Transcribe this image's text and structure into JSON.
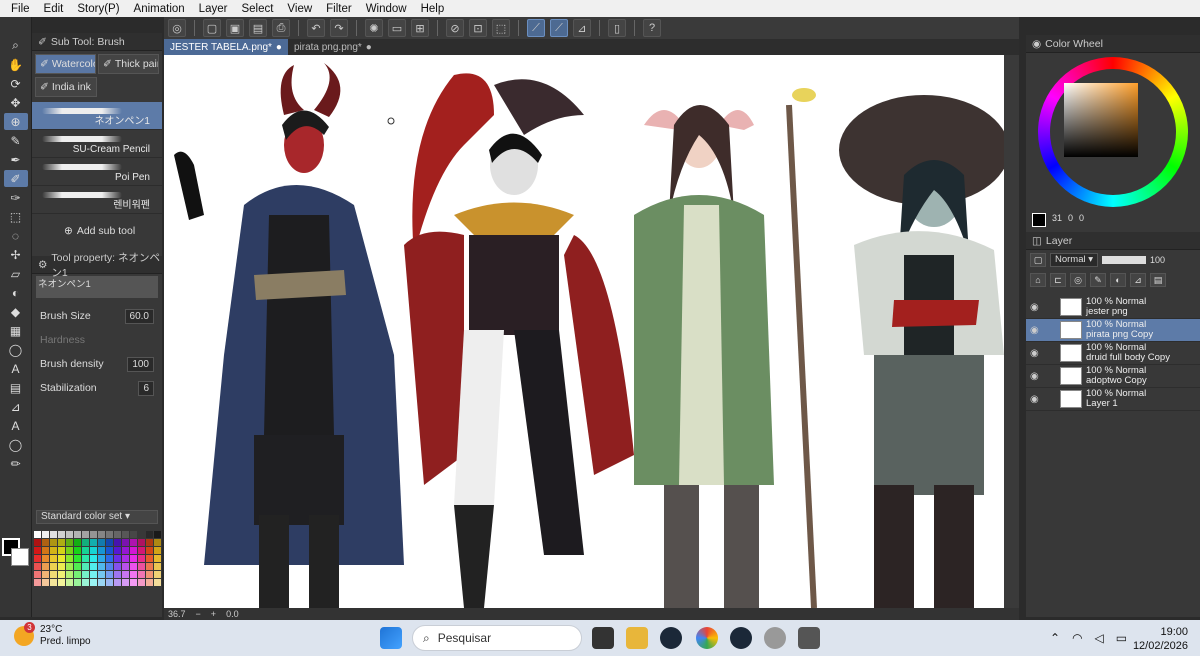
{
  "menu": [
    "File",
    "Edit",
    "Story(P)",
    "Animation",
    "Layer",
    "Select",
    "View",
    "Filter",
    "Window",
    "Help"
  ],
  "document_tabs": [
    {
      "label": "JESTER TABELA.png*",
      "active": true
    },
    {
      "label": "pirata png.png*",
      "active": false
    }
  ],
  "subtool": {
    "header": "Sub Tool: Brush",
    "groups": [
      "Watercolor",
      "Thick paint",
      "India ink"
    ],
    "brushes": [
      {
        "label": "ネオンペン1",
        "selected": true
      },
      {
        "label": "SU-Cream Pencil",
        "selected": false
      },
      {
        "label": "Poi Pen",
        "selected": false
      },
      {
        "label": "렌비워펜",
        "selected": false
      }
    ],
    "add_label": "Add sub tool"
  },
  "tool_property": {
    "header": "Tool property: ネオンペン1",
    "preset_name": "ネオンペン1",
    "brush_size_label": "Brush Size",
    "brush_size_value": "60.0",
    "hardness_label": "Hardness",
    "density_label": "Brush density",
    "density_value": "100",
    "stabilization_label": "Stabilization",
    "stabilization_value": "6"
  },
  "color_set": {
    "label": "Standard color set"
  },
  "status": {
    "zoom": "36.7",
    "angle": "0.0"
  },
  "color_wheel": {
    "header": "Color Wheel",
    "hue_color": "#ff9f2a",
    "numbers": [
      "31",
      "0",
      "0"
    ]
  },
  "layer_panel": {
    "header": "Layer",
    "blend": "Normal",
    "opacity": "100",
    "layers": [
      {
        "line1": "100 % Normal",
        "line2": "jester png",
        "selected": false
      },
      {
        "line1": "100 % Normal",
        "line2": "pirata png Copy",
        "selected": true
      },
      {
        "line1": "100 % Normal",
        "line2": "druid full body Copy",
        "selected": false
      },
      {
        "line1": "100 % Normal",
        "line2": "adoptwo Copy",
        "selected": false
      },
      {
        "line1": "100 % Normal",
        "line2": "Layer 1",
        "selected": false
      }
    ]
  },
  "taskbar": {
    "temp": "23°C",
    "weather": "Pred. limpo",
    "badge": "3",
    "search_placeholder": "Pesquisar",
    "time": "19:00",
    "date": "12/02/2026"
  },
  "colors": {
    "accent": "#5d7ba8",
    "panel": "#383838",
    "taskbar": "#dde4ee"
  }
}
